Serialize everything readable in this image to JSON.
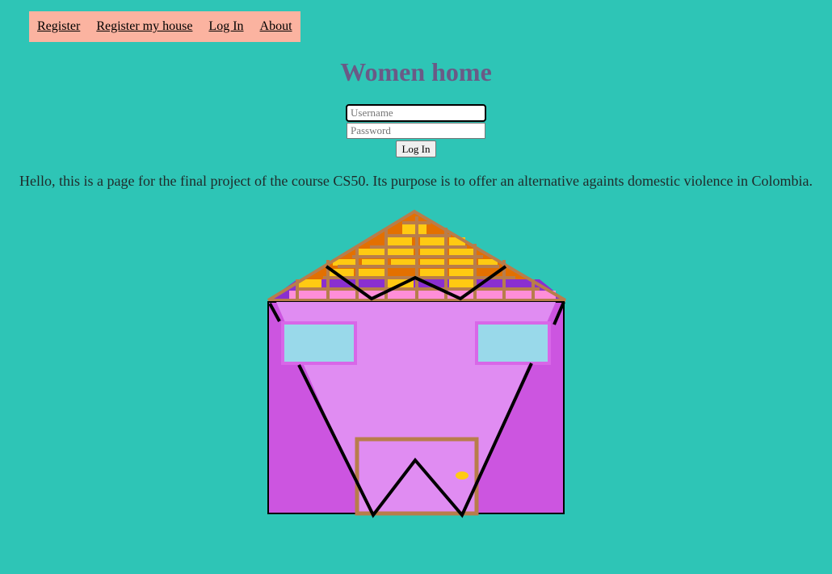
{
  "nav": {
    "items": [
      {
        "label": "Register"
      },
      {
        "label": "Register my house"
      },
      {
        "label": "Log In"
      },
      {
        "label": "About"
      }
    ]
  },
  "page_title": "Women home",
  "login": {
    "username_placeholder": "Username",
    "password_placeholder": "Password",
    "submit_label": "Log In"
  },
  "intro_text": "Hello, this is a page for the final project of the course CS50. Its purpose is to offer an alternative againts domestic violence in Colombia.",
  "colors": {
    "background": "#2ec5b6",
    "nav_background": "#fbb3a0",
    "title": "#6a5a86",
    "house_wall": "#cc55e0",
    "house_front": "#e08cf2",
    "roof_orange": "#e37000",
    "roof_yellow": "#ffca12",
    "roof_frame": "#b87d4b",
    "window": "#99d9ea",
    "door_knob": "#ffca12"
  }
}
